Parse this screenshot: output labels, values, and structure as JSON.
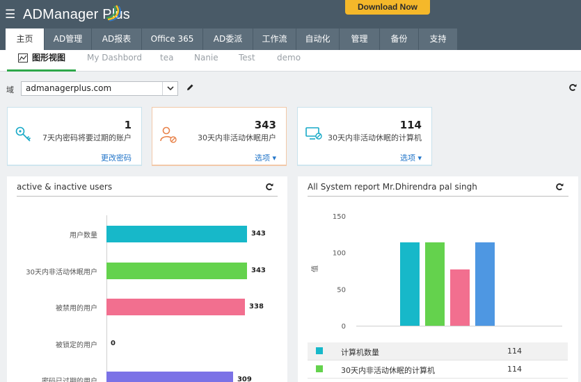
{
  "app": {
    "title": "ADManager Plus",
    "download_label": "Download Now"
  },
  "tabs": [
    {
      "label": "主页"
    },
    {
      "label": "AD管理"
    },
    {
      "label": "AD报表"
    },
    {
      "label": "Office 365"
    },
    {
      "label": "AD委派"
    },
    {
      "label": "工作流"
    },
    {
      "label": "自动化"
    },
    {
      "label": "管理"
    },
    {
      "label": "备份"
    },
    {
      "label": "支持"
    }
  ],
  "subtabs": [
    {
      "label": "图形视图"
    },
    {
      "label": "My Dashbord"
    },
    {
      "label": "tea"
    },
    {
      "label": "Nanie"
    },
    {
      "label": "Test"
    },
    {
      "label": "demo"
    }
  ],
  "domain": {
    "label": "域",
    "value": "admanagerplus.com"
  },
  "cards": [
    {
      "count": "1",
      "desc": "7天内密码将要过期的账户",
      "link": "更改密码"
    },
    {
      "count": "343",
      "desc": "30天内非活动休眠用户",
      "link": "选项"
    },
    {
      "count": "114",
      "desc": "30天内非活动休眠的计算机",
      "link": "选项"
    }
  ],
  "panels": {
    "users_title": "active & inactive users",
    "system_title": "All System report Mr.Dhirendra pal singh"
  },
  "colors": {
    "teal": "#17b8c9",
    "green": "#64d24d",
    "pink": "#f26f8f",
    "purple": "#7b72e6",
    "blue": "#4e97e2"
  },
  "chart_data": [
    {
      "type": "bar",
      "orientation": "horizontal",
      "title": "active & inactive users",
      "categories": [
        "用户数量",
        "30天内非活动休眠用户",
        "被禁用的用户",
        "被锁定的用户",
        "密码已过期的用户"
      ],
      "values": [
        343,
        343,
        338,
        0,
        309
      ],
      "colors": [
        "#17b8c9",
        "#64d24d",
        "#f26f8f",
        "#17b8c9",
        "#7b72e6"
      ]
    },
    {
      "type": "bar",
      "title": "All System report Mr.Dhirendra pal singh",
      "ylabel": "值",
      "ylim": [
        0,
        150
      ],
      "yticks": [
        "150",
        "100",
        "50",
        "0"
      ],
      "values": [
        114,
        114,
        77,
        114
      ],
      "colors": [
        "#17b8c9",
        "#64d24d",
        "#f26f8f",
        "#4e97e2"
      ],
      "legend": [
        {
          "name": "计算机数量",
          "value": "114",
          "color": "#17b8c9"
        },
        {
          "name": "30天内非活动休眠的计算机",
          "value": "114",
          "color": "#64d24d"
        }
      ]
    }
  ]
}
